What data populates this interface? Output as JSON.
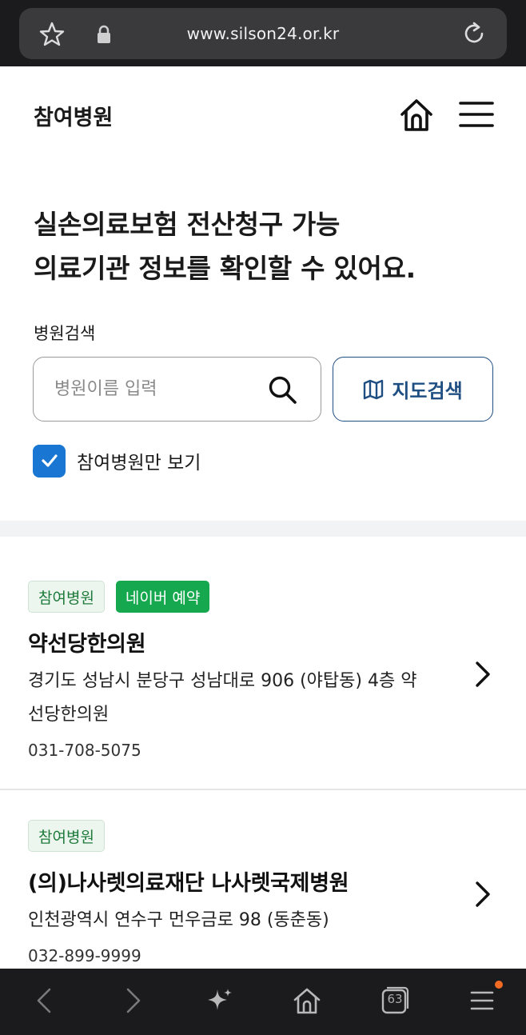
{
  "browser": {
    "url": "www.silson24.or.kr",
    "tab_count": "63"
  },
  "header": {
    "title": "참여병원"
  },
  "headline": {
    "line1": "실손의료보험 전산청구 가능",
    "line2": "의료기관 정보를 확인할 수 있어요."
  },
  "search": {
    "label": "병원검색",
    "placeholder": "병원이름 입력",
    "map_button_label": "지도검색"
  },
  "filter": {
    "checkbox_label": "참여병원만 보기",
    "checked": true
  },
  "hospitals": [
    {
      "badges": [
        "참여병원",
        "네이버 예약"
      ],
      "name": "약선당한의원",
      "address_line1": "경기도 성남시 분당구 성남대로 906 (야탑동) 4층 약",
      "address_line2": "선당한의원",
      "phone": "031-708-5075"
    },
    {
      "badges": [
        "참여병원"
      ],
      "name": "(의)나사렛의료재단 나사렛국제병원",
      "address_line1": "인천광역시 연수구 먼우금로 98 (동춘동)",
      "phone": "032-899-9999"
    }
  ],
  "colors": {
    "accent_blue": "#1f4f82",
    "checkbox_blue": "#1976d2",
    "badge_green": "#16a84e",
    "badge_participate_text": "#1e7a3a",
    "notification_dot": "#f36b22"
  }
}
